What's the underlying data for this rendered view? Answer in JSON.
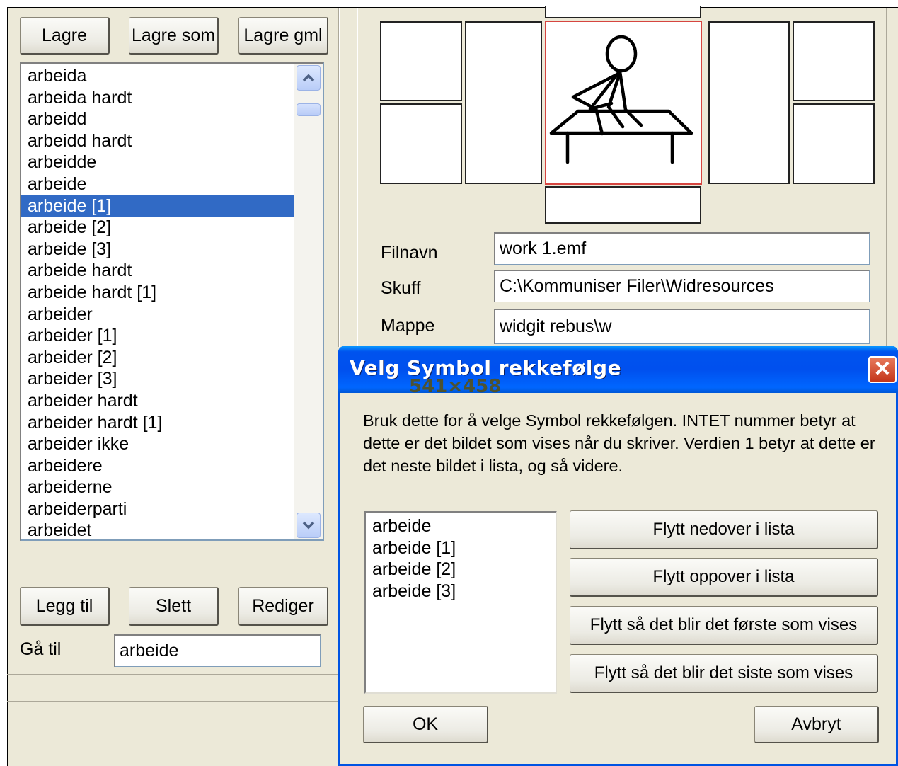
{
  "toolbar": {
    "save": "Lagre",
    "save_as": "Lagre som",
    "save_old": "Lagre gml"
  },
  "word_list": {
    "items": [
      "arbeida",
      "arbeida hardt",
      "arbeidd",
      "arbeidd hardt",
      "arbeidde",
      "arbeide",
      "arbeide [1]",
      "arbeide [2]",
      "arbeide [3]",
      "arbeide hardt",
      "arbeide hardt [1]",
      "arbeider",
      "arbeider [1]",
      "arbeider [2]",
      "arbeider [3]",
      "arbeider hardt",
      "arbeider hardt [1]",
      "arbeider ikke",
      "arbeidere",
      "arbeiderne",
      "arbeiderparti",
      "arbeidet"
    ],
    "selected": "arbeide [1]"
  },
  "actions": {
    "add": "Legg til",
    "delete": "Slett",
    "edit": "Rediger"
  },
  "goto": {
    "label": "Gå til",
    "value": "arbeide"
  },
  "symbol_info": {
    "filename_label": "Filnavn",
    "filename_value": "work 1.emf",
    "drawer_label": "Skuff",
    "drawer_value": "C:\\Kommuniser Filer\\Widresources",
    "folder_label": "Mappe",
    "folder_value": "widgit rebus\\w",
    "size_text": "541×458"
  },
  "dialog": {
    "title": "Velg Symbol rekkefølge",
    "description": "Bruk dette for å velge Symbol rekkefølgen. INTET nummer betyr at dette er det bildet som vises når du skriver. Verdien 1 betyr at dette er det neste bildet i lista, og så videre.",
    "order_list": [
      "arbeide",
      "arbeide [1]",
      "arbeide [2]",
      "arbeide [3]"
    ],
    "move_down": "Flytt nedover i lista",
    "move_up": "Flytt oppover i lista",
    "move_first": "Flytt så det blir det første som vises",
    "move_last": "Flytt så det blir det siste som vises",
    "ok": "OK",
    "cancel": "Avbryt"
  },
  "icons": {
    "close": "close-icon",
    "scroll_up": "chevron-up-icon",
    "scroll_down": "chevron-down-icon",
    "symbol": "person-working-at-desk-icon"
  },
  "colors": {
    "window_bg": "#ece9d8",
    "selection": "#316ac5",
    "titlebar": "#0054e3",
    "active_cell_border": "#d64540"
  }
}
